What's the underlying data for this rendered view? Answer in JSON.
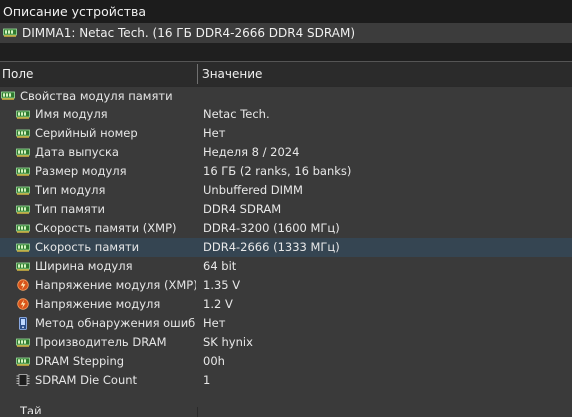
{
  "header": {
    "title": "Описание устройства"
  },
  "device": {
    "label": "DIMMA1: Netac Tech. (16 ГБ DDR4-2666 DDR4 SDRAM)"
  },
  "columns": {
    "field": "Поле",
    "value": "Значение"
  },
  "group": {
    "label": "Свойства модуля памяти"
  },
  "properties": [
    {
      "label": "Имя модуля",
      "value": "Netac Tech.",
      "icon": "memory-module-icon"
    },
    {
      "label": "Серийный номер",
      "value": "Нет",
      "icon": "memory-module-icon"
    },
    {
      "label": "Дата выпуска",
      "value": "Неделя 8 / 2024",
      "icon": "memory-module-icon"
    },
    {
      "label": "Размер модуля",
      "value": "16 ГБ (2 ranks, 16 banks)",
      "icon": "memory-module-icon"
    },
    {
      "label": "Тип модуля",
      "value": "Unbuffered DIMM",
      "icon": "memory-module-icon"
    },
    {
      "label": "Тип памяти",
      "value": "DDR4 SDRAM",
      "icon": "memory-module-icon"
    },
    {
      "label": "Скорость памяти (XMP)",
      "value": "DDR4-3200 (1600 МГц)",
      "icon": "memory-module-icon"
    },
    {
      "label": "Скорость памяти",
      "value": "DDR4-2666 (1333 МГц)",
      "icon": "memory-module-icon",
      "selected": true
    },
    {
      "label": "Ширина модуля",
      "value": "64 bit",
      "icon": "memory-module-icon"
    },
    {
      "label": "Напряжение модуля (XMP)",
      "value": "1.35 V",
      "icon": "voltage-icon"
    },
    {
      "label": "Напряжение модуля",
      "value": "1.2 V",
      "icon": "voltage-icon"
    },
    {
      "label": "Метод обнаружения ошиб...",
      "value": "Нет",
      "icon": "device-icon"
    },
    {
      "label": "Производитель DRAM",
      "value": "SK hynix",
      "icon": "memory-module-icon"
    },
    {
      "label": "DRAM Stepping",
      "value": "00h",
      "icon": "memory-module-icon"
    },
    {
      "label": "SDRAM Die Count",
      "value": "1",
      "icon": "chip-icon"
    }
  ],
  "next_group": {
    "label": "Тай"
  }
}
